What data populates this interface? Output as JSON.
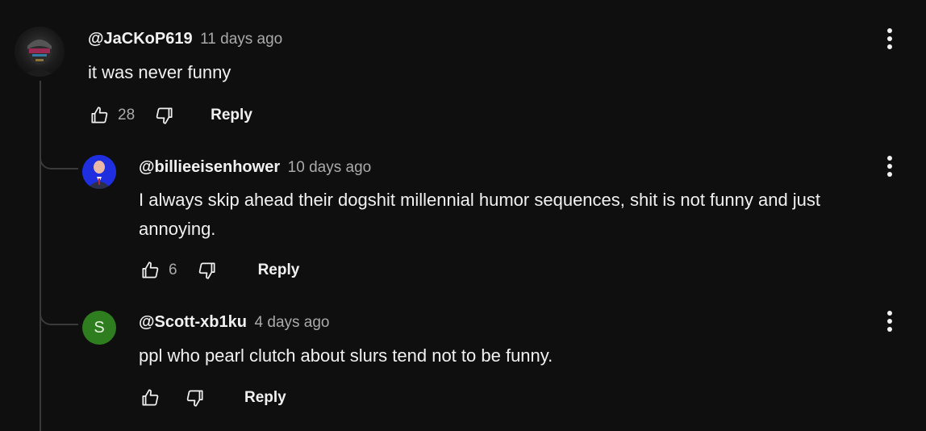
{
  "comments": [
    {
      "author": "@JaCKoP619",
      "time": "11 days ago",
      "text": "it was never funny",
      "likes": "28",
      "reply_label": "Reply",
      "avatar_icon": "dark-portrait-avatar"
    }
  ],
  "replies": [
    {
      "author": "@billieeisenhower",
      "time": "10 days ago",
      "text_line1": "I always skip ahead their dogshit millennial humor sequences, shit is not funny and just",
      "text_line2": "annoying.",
      "likes": "6",
      "reply_label": "Reply",
      "avatar_icon": "man-in-suit-blue-background-avatar"
    },
    {
      "author": "@Scott-xb1ku",
      "time": "4 days ago",
      "text": "ppl who pearl clutch about slurs tend not to be funny.",
      "likes": "",
      "reply_label": "Reply",
      "avatar_letter": "S",
      "avatar_color": "#2e7d1e"
    }
  ],
  "icons": {
    "like": "thumbs-up-icon",
    "dislike": "thumbs-down-icon",
    "menu": "more-vertical-icon"
  }
}
